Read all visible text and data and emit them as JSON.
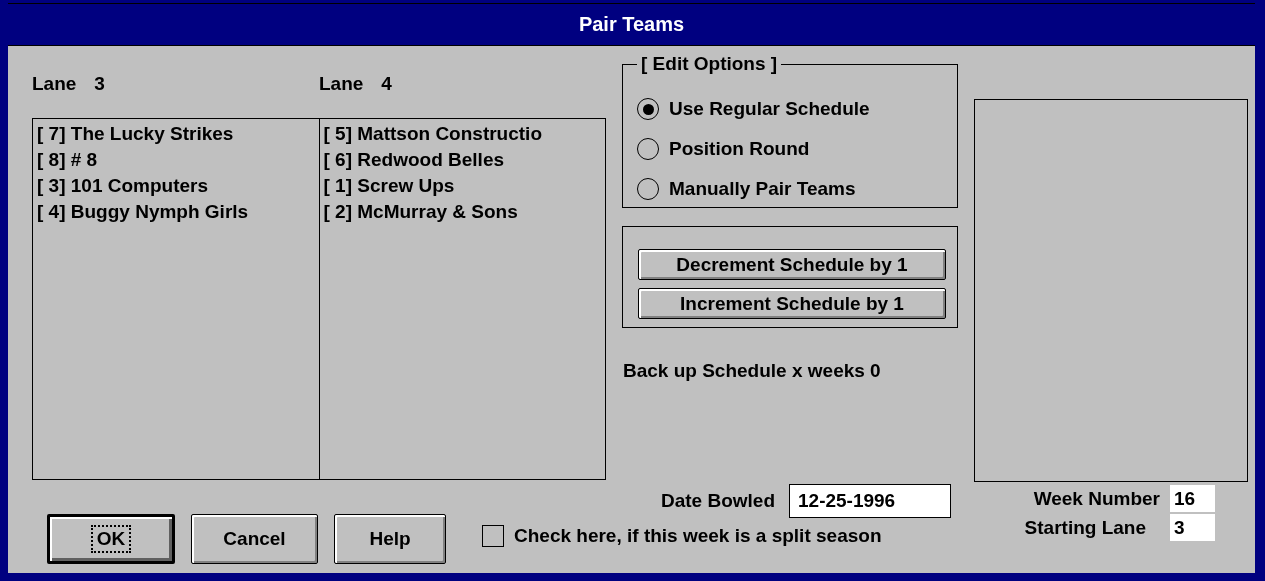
{
  "window": {
    "title": "Pair Teams"
  },
  "lanes": [
    {
      "label": "Lane",
      "number": "3",
      "teams": [
        "[ 7] The Lucky Strikes",
        "[ 8] # 8",
        "[ 3] 101 Computers",
        "[ 4] Buggy Nymph Girls"
      ]
    },
    {
      "label": "Lane",
      "number": "4",
      "teams": [
        "[ 5] Mattson Constructio",
        "[ 6] Redwood Belles",
        "[ 1] Screw Ups",
        "[ 2] McMurray & Sons"
      ]
    }
  ],
  "edit_options": {
    "title": "[ Edit Options ]",
    "options": [
      {
        "label": "Use Regular Schedule",
        "selected": true
      },
      {
        "label": "Position Round",
        "selected": false
      },
      {
        "label": "Manually Pair Teams",
        "selected": false
      }
    ]
  },
  "schedule_buttons": [
    "Decrement Schedule by 1",
    "Increment Schedule by 1"
  ],
  "backup_text": "Back up Schedule x weeks 0",
  "date_bowled": {
    "label": "Date Bowled",
    "value": "12-25-1996"
  },
  "week_number": {
    "label": "Week Number",
    "value": "16"
  },
  "starting_lane": {
    "label": "Starting Lane",
    "value": "3"
  },
  "buttons": [
    {
      "label": "OK",
      "focused": true
    },
    {
      "label": "Cancel",
      "focused": false
    },
    {
      "label": "Help",
      "focused": false
    }
  ],
  "split_season": {
    "label": "Check here, if this week is a split season",
    "checked": false
  }
}
